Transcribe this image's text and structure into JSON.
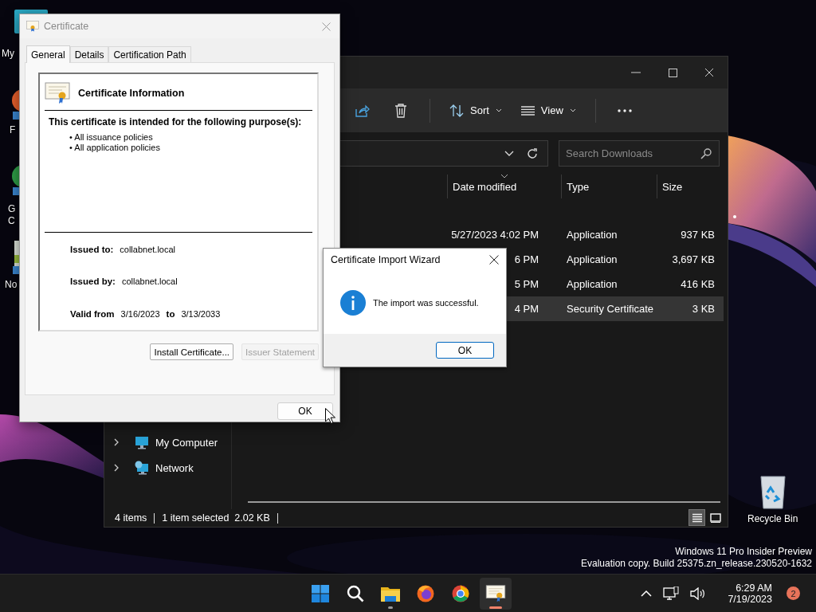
{
  "desktop": {
    "icons": [
      {
        "kind": "tile",
        "lines": [
          "My"
        ]
      },
      {
        "kind": "orange",
        "lines": [
          "F"
        ]
      },
      {
        "kind": "green",
        "lines": [
          "G",
          "C"
        ]
      },
      {
        "kind": "notepad",
        "lines": [
          "No"
        ]
      }
    ],
    "recycle_bin": "Recycle Bin",
    "watermark": [
      "Windows 11 Pro Insider Preview",
      "Evaluation copy. Build 25375.zn_release.230520-1632"
    ]
  },
  "explorer": {
    "toolbar": {
      "sort": "Sort",
      "view": "View"
    },
    "search": {
      "placeholder": "Search Downloads"
    },
    "columns": [
      {
        "label": "Date modified",
        "sorted": true
      },
      {
        "label": "Type",
        "sorted": false
      },
      {
        "label": "Size",
        "sorted": false
      }
    ],
    "rows": [
      {
        "date_modified": "5/27/2023 4:02 PM",
        "type": "Application",
        "size": "937 KB",
        "selected": false
      },
      {
        "date_modified": "6 PM",
        "type": "Application",
        "size": "3,697 KB",
        "selected": false
      },
      {
        "date_modified": "5 PM",
        "type": "Application",
        "size": "416 KB",
        "selected": false
      },
      {
        "date_modified": "4 PM",
        "type": "Security Certificate",
        "size": "3 KB",
        "selected": true
      }
    ],
    "sidebar": [
      {
        "kind": "computer",
        "label": "My Computer"
      },
      {
        "kind": "network",
        "label": "Network"
      }
    ],
    "status_bar": {
      "items": "4 items",
      "selection": "1 item selected",
      "selection_size": "2.02 KB"
    },
    "view_modes": [
      {
        "kind": "details",
        "selected": true
      },
      {
        "kind": "tiles",
        "selected": false
      }
    ]
  },
  "certificate": {
    "title": "Certificate",
    "tabs": [
      {
        "label": "General",
        "selected": true
      },
      {
        "label": "Details",
        "selected": false
      },
      {
        "label": "Certification Path",
        "selected": false
      }
    ],
    "heading": "Certificate Information",
    "purpose_heading": "This certificate is intended for the following purpose(s):",
    "purposes": [
      "• All issuance policies",
      "• All application policies"
    ],
    "fields": [
      {
        "label": "Issued to:",
        "value": "collabnet.local"
      },
      {
        "label": "Issued by:",
        "value": "collabnet.local"
      }
    ],
    "validity": {
      "from_label": "Valid from",
      "from": "3/16/2023",
      "to_label": "to",
      "to": "3/13/2033"
    },
    "buttons": [
      {
        "label": "Install Certificate...",
        "disabled": false
      },
      {
        "label": "Issuer Statement",
        "disabled": true
      }
    ],
    "ok": "OK"
  },
  "wizard": {
    "title": "Certificate Import Wizard",
    "message": "The import was successful.",
    "ok": "OK"
  },
  "taskbar": {
    "apps": [
      {
        "kind": "start",
        "active": false,
        "running": false
      },
      {
        "kind": "search",
        "active": false,
        "running": false
      },
      {
        "kind": "files",
        "active": false,
        "running": true
      },
      {
        "kind": "foxbrowser",
        "active": false,
        "running": false
      },
      {
        "kind": "wheelbrowser",
        "active": false,
        "running": false
      },
      {
        "kind": "certificate",
        "active": true,
        "running": true
      }
    ],
    "time": "6:29 AM",
    "date": "7/19/2023",
    "notifications": "2"
  }
}
